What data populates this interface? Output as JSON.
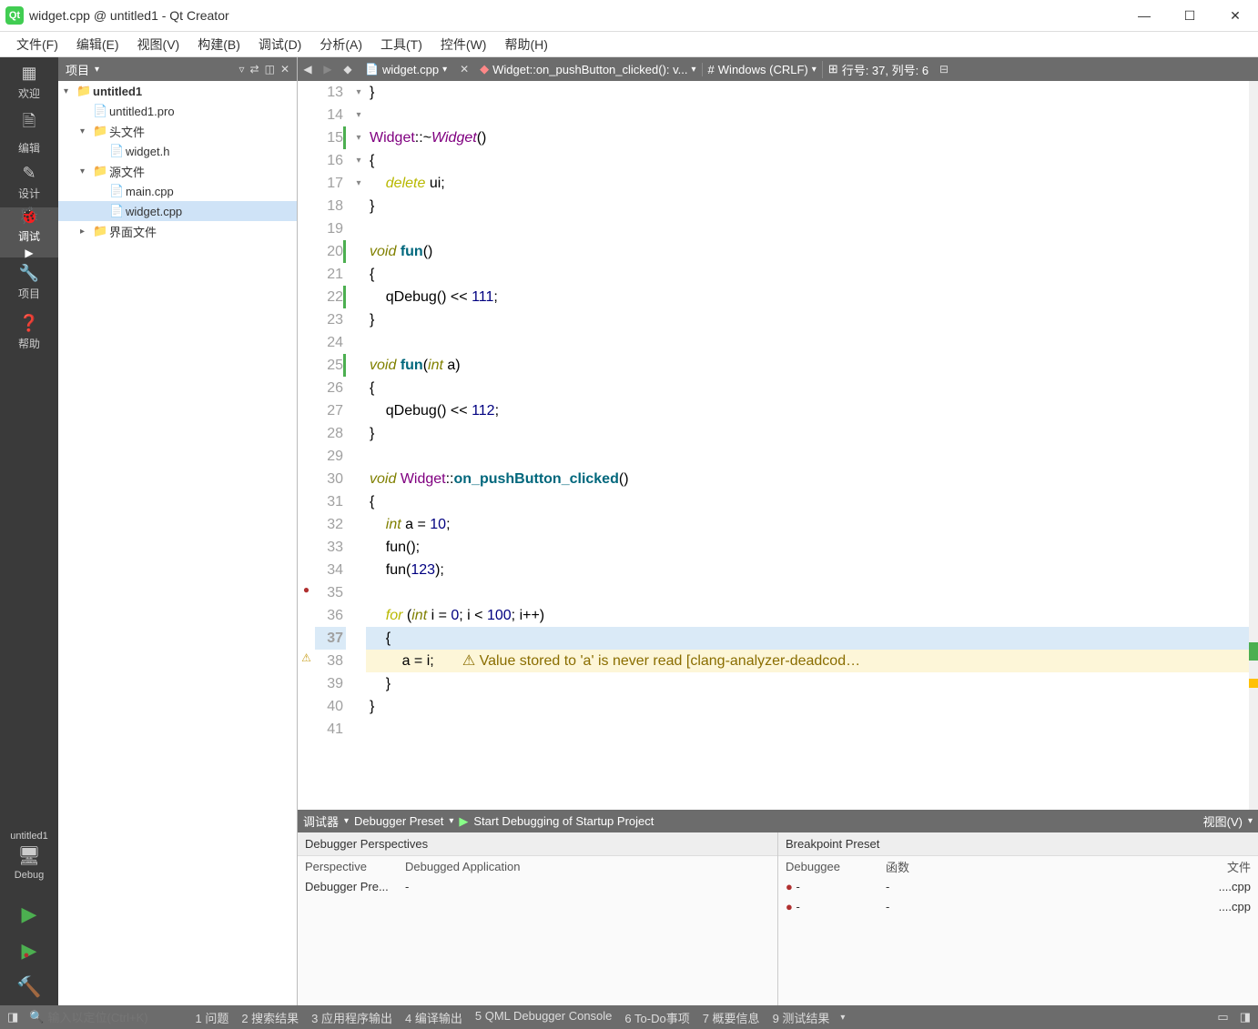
{
  "title": "widget.cpp @ untitled1 - Qt Creator",
  "menu": [
    "文件(F)",
    "编辑(E)",
    "视图(V)",
    "构建(B)",
    "调试(D)",
    "分析(A)",
    "工具(T)",
    "控件(W)",
    "帮助(H)"
  ],
  "modes": [
    {
      "icon": "▦",
      "label": "欢迎"
    },
    {
      "icon": "🗎",
      "label": "编辑"
    },
    {
      "icon": "✎",
      "label": "设计"
    },
    {
      "icon": "🐞",
      "label": "调试",
      "active": true,
      "arrow": true
    },
    {
      "icon": "🔧",
      "label": "项目"
    },
    {
      "icon": "❓",
      "label": "帮助"
    }
  ],
  "target": {
    "name": "untitled1",
    "config": "Debug"
  },
  "project_panel_title": "项目",
  "tree": [
    {
      "indent": 0,
      "exp": "▾",
      "icon": "📁",
      "cls": "folder",
      "name": "untitled1",
      "bold": true
    },
    {
      "indent": 1,
      "exp": "",
      "icon": "📄",
      "name": "untitled1.pro"
    },
    {
      "indent": 1,
      "exp": "▾",
      "icon": "📁",
      "cls": "folder",
      "name": "头文件"
    },
    {
      "indent": 2,
      "exp": "",
      "icon": "📄",
      "name": "widget.h"
    },
    {
      "indent": 1,
      "exp": "▾",
      "icon": "📁",
      "cls": "folder",
      "name": "源文件"
    },
    {
      "indent": 2,
      "exp": "",
      "icon": "📄",
      "name": "main.cpp"
    },
    {
      "indent": 2,
      "exp": "",
      "icon": "📄",
      "name": "widget.cpp",
      "sel": true
    },
    {
      "indent": 1,
      "exp": "▸",
      "icon": "📁",
      "cls": "folder",
      "name": "界面文件"
    }
  ],
  "open_file": "widget.cpp",
  "func_dropdown": "Widget::on_pushButton_clicked(): v...",
  "encoding_label": "Windows (CRLF)",
  "cursor_label": "行号: 37, 列号: 6",
  "code": [
    {
      "n": 13,
      "html": "}"
    },
    {
      "n": 14,
      "html": ""
    },
    {
      "n": 15,
      "fold": "▾",
      "gmark": true,
      "html": "<span class='cls'>Widget</span>::~<span class='cls' style='font-style:italic'>Widget</span>()"
    },
    {
      "n": 16,
      "html": "{"
    },
    {
      "n": 17,
      "html": "    <span class='kw'>delete</span> ui;"
    },
    {
      "n": 18,
      "html": "}"
    },
    {
      "n": 19,
      "html": ""
    },
    {
      "n": 20,
      "fold": "▾",
      "gmark": true,
      "html": "<span class='type'>void</span> <span class='func' style='font-weight:bold'>fun</span>()"
    },
    {
      "n": 21,
      "html": "{"
    },
    {
      "n": 22,
      "gmark": true,
      "html": "    qDebug() &lt;&lt; <span class='num'>111</span>;"
    },
    {
      "n": 23,
      "html": "}"
    },
    {
      "n": 24,
      "html": ""
    },
    {
      "n": 25,
      "fold": "▾",
      "gmark": true,
      "html": "<span class='type'>void</span> <span class='func' style='font-weight:bold'>fun</span>(<span class='type'>int</span> a)"
    },
    {
      "n": 26,
      "html": "{"
    },
    {
      "n": 27,
      "html": "    qDebug() &lt;&lt; <span class='num'>112</span>;"
    },
    {
      "n": 28,
      "html": "}"
    },
    {
      "n": 29,
      "html": ""
    },
    {
      "n": 30,
      "fold": "▾",
      "html": "<span class='type'>void</span> <span class='cls'>Widget</span>::<span class='func' style='font-weight:bold'>on_pushButton_clicked</span>()"
    },
    {
      "n": 31,
      "html": "{"
    },
    {
      "n": 32,
      "html": "    <span class='type'>int</span> a = <span class='num'>10</span>;"
    },
    {
      "n": 33,
      "html": "    fun();"
    },
    {
      "n": 34,
      "html": "    fun(<span class='num'>123</span>);"
    },
    {
      "n": 35,
      "bp": true,
      "html": ""
    },
    {
      "n": 36,
      "fold": "▾",
      "html": "    <span class='kw'>for</span> (<span class='type'>int</span> i = <span class='num'>0</span>; i &lt; <span class='num'>100</span>; i++)"
    },
    {
      "n": 37,
      "hl": true,
      "bold": true,
      "html": "    {"
    },
    {
      "n": 38,
      "warn": true,
      "html": "        a = i;       <span class='warn-txt'>⚠ Value stored to 'a' is never read [clang-analyzer-deadcod…</span>"
    },
    {
      "n": 39,
      "html": "    }"
    },
    {
      "n": 40,
      "html": "}"
    },
    {
      "n": 41,
      "html": ""
    }
  ],
  "debug_toolbar": {
    "label": "调试器",
    "preset": "Debugger Preset",
    "start": "Start Debugging of Startup Project",
    "view": "视图(V)"
  },
  "dpanel1": {
    "title": "Debugger Perspectives",
    "h1": "Perspective",
    "h2": "Debugged Application",
    "r1": "Debugger Pre...",
    "r2": "-"
  },
  "dpanel2": {
    "title": "Breakpoint Preset",
    "h1": "Debuggee",
    "h2": "函数",
    "h3": "文件",
    "rows": [
      [
        "-",
        "-",
        "....cpp"
      ],
      [
        "-",
        "-",
        "....cpp"
      ]
    ]
  },
  "footer": {
    "locator_ph": "输入以定位(Ctrl+K)",
    "items": [
      "1 问题",
      "2 搜索结果",
      "3 应用程序输出",
      "4 编译输出",
      "5 QML Debugger Console",
      "6 To-Do事项",
      "7 概要信息",
      "9 测试结果"
    ]
  }
}
